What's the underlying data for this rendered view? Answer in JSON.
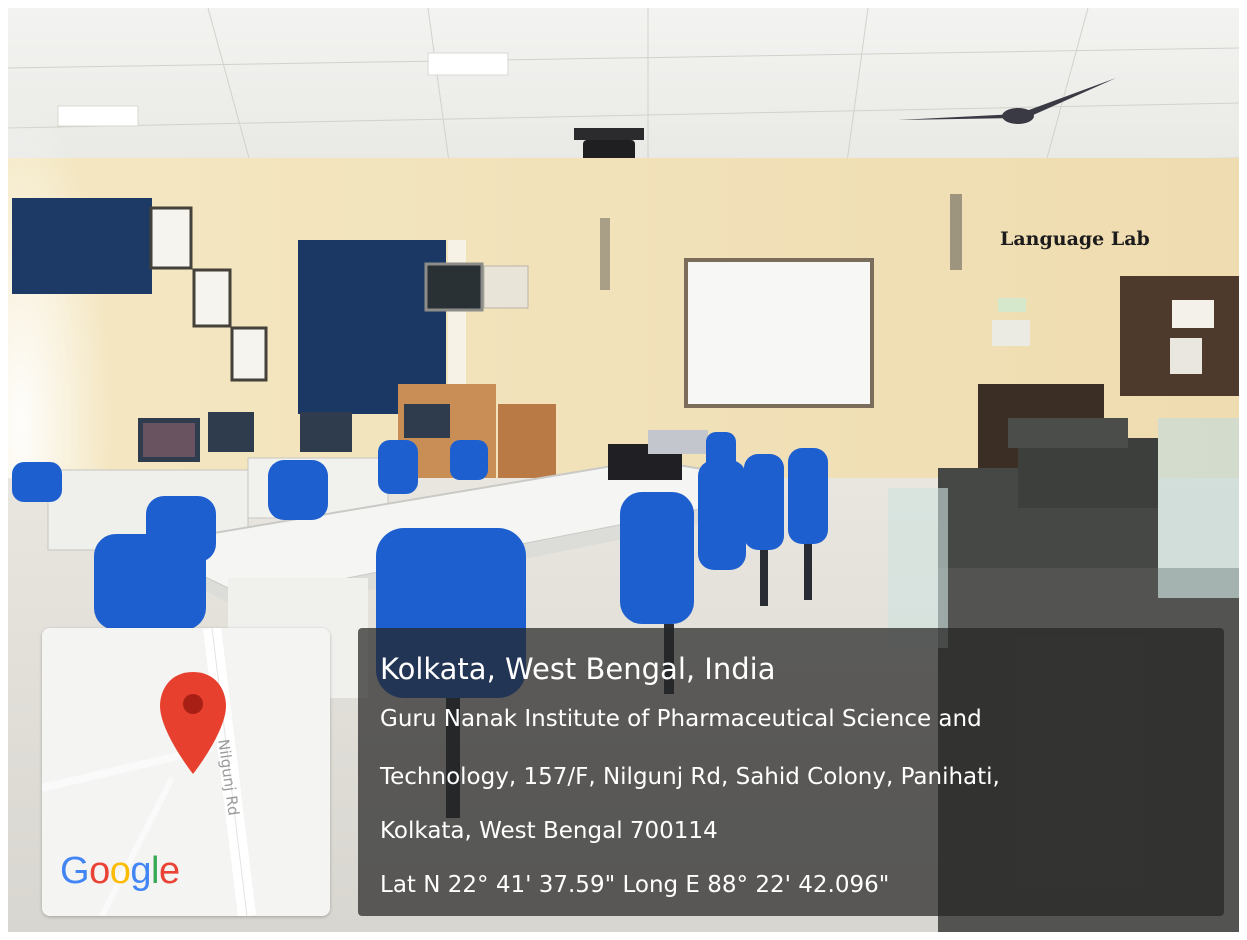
{
  "photo": {
    "scene": "computer language lab with blue chairs, white conference table, projector and whiteboard",
    "caption": "Language Lab"
  },
  "map": {
    "road_label": "Nilgunj Rd",
    "pin_color": "#e8402f",
    "logo": "Google",
    "logo_colors": [
      "#4285f4",
      "#ea4335",
      "#fbbc05",
      "#4285f4",
      "#34a853",
      "#ea4335"
    ]
  },
  "location": {
    "city_line": "Kolkata, West Bengal, India",
    "address_line1": "Guru Nanak Institute of Pharmaceutical Science and",
    "address_line2": "Technology, 157/F, Nilgunj Rd, Sahid Colony, Panihati,",
    "address_line3": "Kolkata, West Bengal 700114",
    "coordinates": "Lat N 22° 41' 37.59\" Long E 88° 22' 42.096\""
  }
}
